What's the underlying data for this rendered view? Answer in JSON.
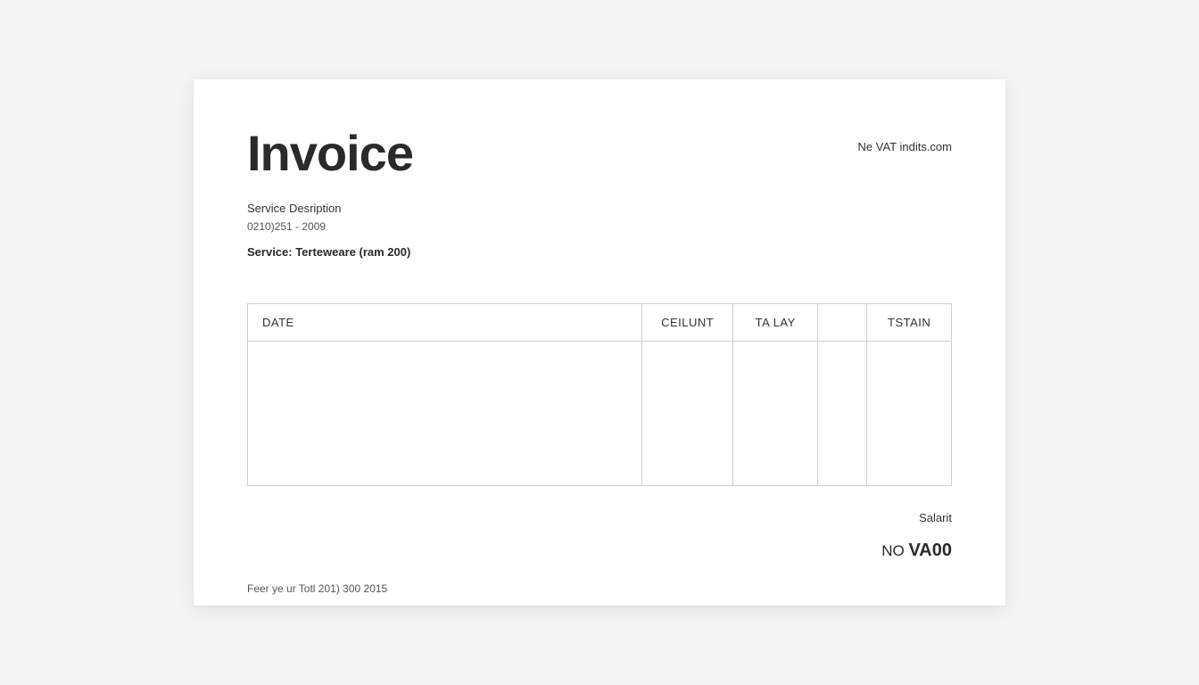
{
  "header": {
    "title": "Invoice",
    "top_right": "Ne VAT indits.com"
  },
  "meta": {
    "service_label": "Service Desription",
    "number": "0210)251 - 2009",
    "subline": "Service: Terteweare (ram 200)"
  },
  "table": {
    "headers": {
      "date": "DATE",
      "col2": "CEILUNT",
      "col3": "TA LAY",
      "col4": "",
      "col5": "TSTAIN"
    }
  },
  "totals": {
    "subtotal_label": "Salarit",
    "no_prefix": "NO ",
    "vat_code": "VA00"
  },
  "footer": {
    "text": "Feer ye ur Totl 201) 300 2015"
  }
}
